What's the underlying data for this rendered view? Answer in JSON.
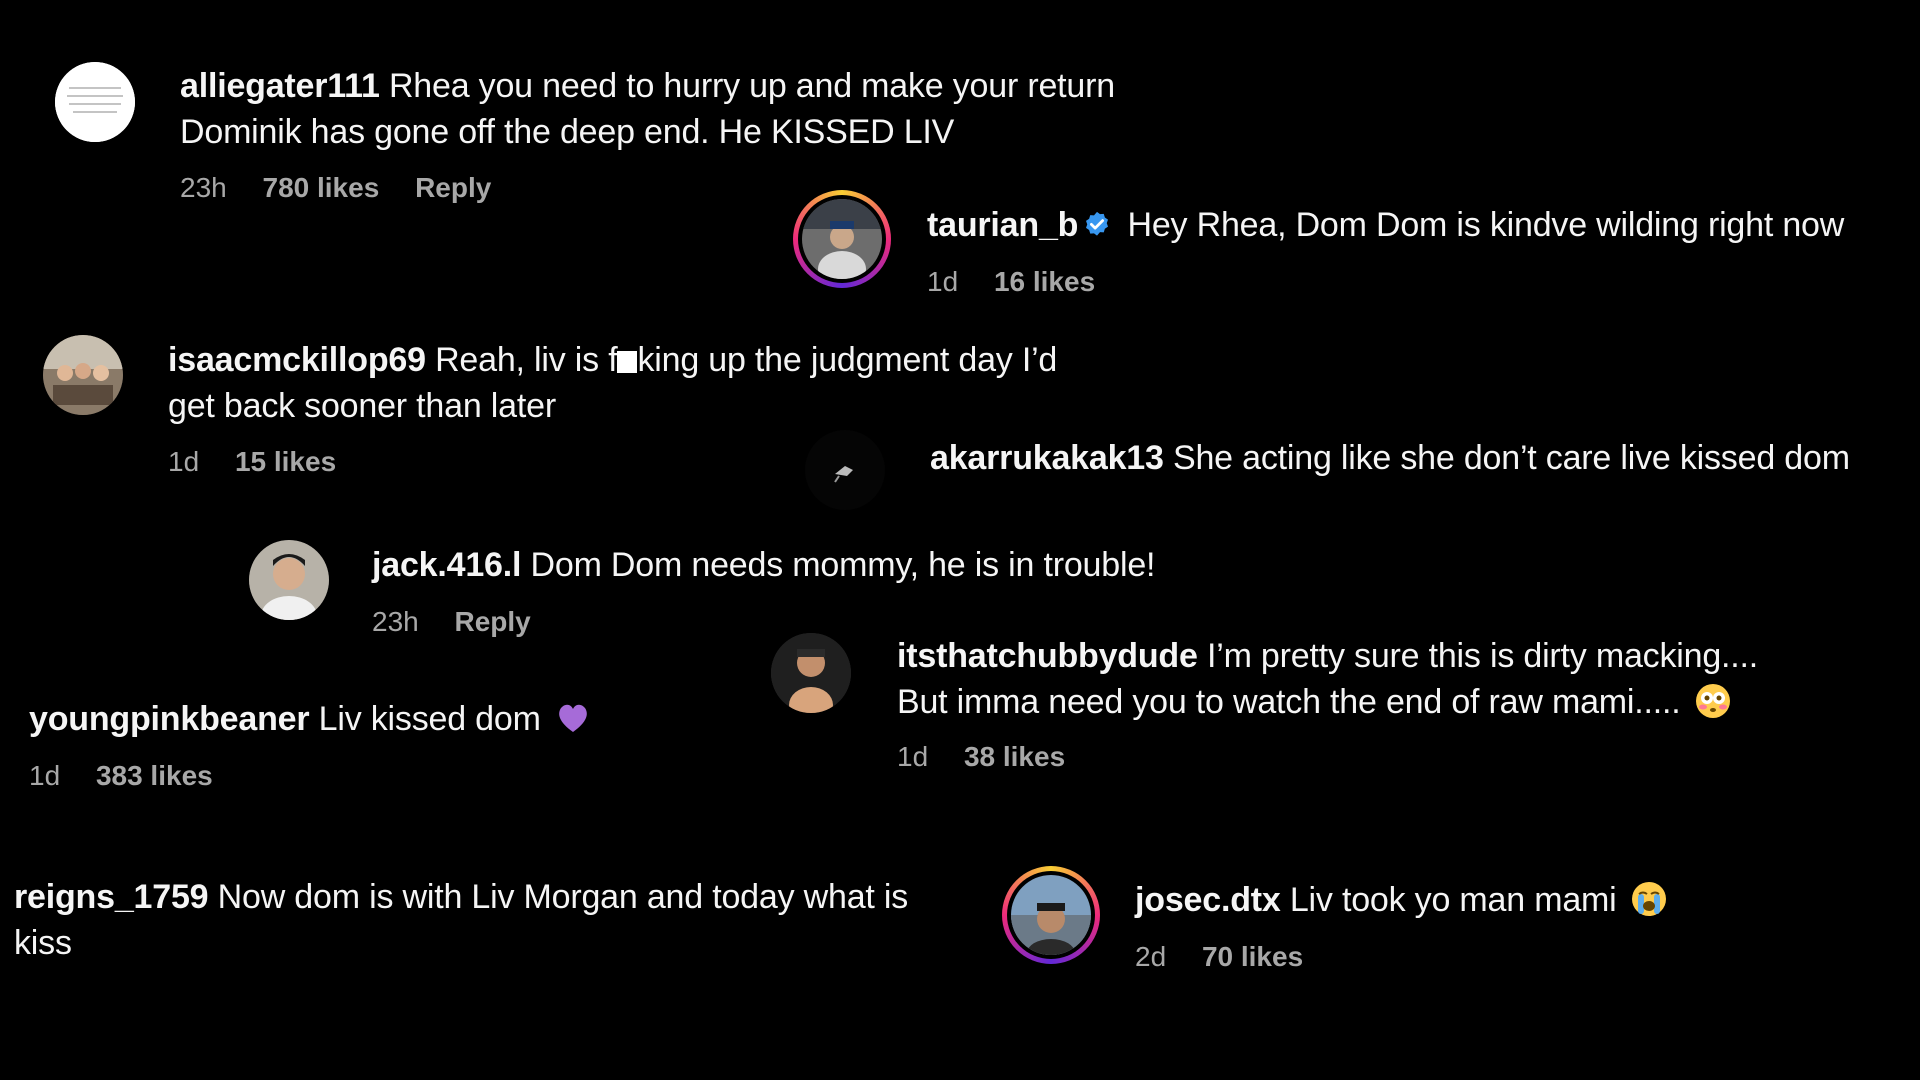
{
  "comments": [
    {
      "username": "alliegater111",
      "text_line1": "Rhea you need to hurry up and make your return",
      "text_line2": "Dominik has gone off the deep end. He KISSED LIV",
      "time": "23h",
      "likes": "780 likes",
      "reply": "Reply"
    },
    {
      "username": "taurian_b",
      "text": "Hey Rhea, Dom Dom is kindve wilding right now",
      "time": "1d",
      "likes": "16 likes"
    },
    {
      "username": "isaacmckillop69",
      "text_before": "Reah, liv is f",
      "text_after": "king up the judgment day I’d",
      "text_line2": "get back sooner than later",
      "time": "1d",
      "likes": "15 likes"
    },
    {
      "username": "akarrukakak13",
      "text": "She acting like she don’t care live kissed dom"
    },
    {
      "username": "jack.416.l",
      "text": "Dom Dom needs mommy, he is in trouble!",
      "time": "23h",
      "reply": "Reply"
    },
    {
      "username": "itsthatchubbydude",
      "text_line1": "I’m pretty sure this is dirty macking....",
      "text_line2": "But imma need you to watch the end of raw mami.....",
      "time": "1d",
      "likes": "38 likes"
    },
    {
      "username": "youngpinkbeaner",
      "text": "Liv kissed dom",
      "time": "1d",
      "likes": "383 likes"
    },
    {
      "username": "reigns_1759",
      "text_line1": "Now dom is with Liv Morgan and today what is",
      "text_line2": "kiss"
    },
    {
      "username": "josec.dtx",
      "text": "Liv took yo man mami",
      "time": "2d",
      "likes": "70 likes"
    }
  ],
  "colors": {
    "background": "#000000",
    "text": "#f5f5f5",
    "meta": "#a8a8a8",
    "verified": "#3897f0",
    "heart": "#a66bd8"
  },
  "icons": {
    "verified": "verified-badge-icon",
    "heart": "purple-heart-emoji",
    "eyes": "flushed-face-emoji",
    "cry": "loudly-crying-face-emoji"
  }
}
